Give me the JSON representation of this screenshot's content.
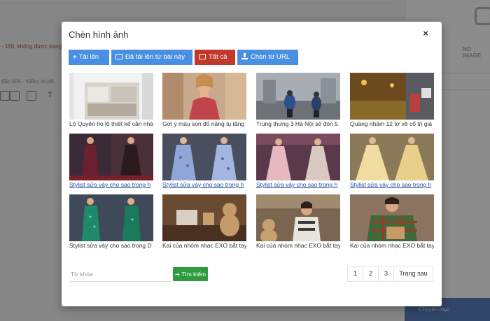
{
  "background": {
    "text1": "- 160, không được trang",
    "text2": "đặc biệt · Kiểm duyệt",
    "noimage": "NO IMAGE",
    "bottom_button": "Chuyên mục"
  },
  "modal": {
    "title": "Chèn hình ảnh",
    "close": "×",
    "tabs": [
      {
        "label": "Tải lên",
        "color": "#4a90e2"
      },
      {
        "label": "Đã tải lên từ bài này",
        "color": "#4a90e2"
      },
      {
        "label": "Tất cả",
        "color": "#c0392b"
      },
      {
        "label": "Chèn từ URL",
        "color": "#4a90e2"
      }
    ],
    "images": [
      {
        "caption": "Lộ Quyên ho lộ thiết kế căn nhà",
        "underline": false,
        "icon": "house-interior-image"
      },
      {
        "caption": "Gợi ý màu son đỏ nâng tụ tăng",
        "underline": false,
        "icon": "model-portrait-image"
      },
      {
        "caption": "Trung thưng 3 Hà Nội sẽ đón 5",
        "underline": false,
        "icon": "street-motorbike-image"
      },
      {
        "caption": "Quảng nhâm 12 tơ vẽ cổ trị giá",
        "underline": false,
        "icon": "night-street-image"
      },
      {
        "caption": "Stylist sửa váy cho sao trong h",
        "underline": true,
        "icon": "red-carpet-dress-image"
      },
      {
        "caption": "Stylist sửa váy cho sao trong h",
        "underline": true,
        "icon": "blue-dress-image"
      },
      {
        "caption": "Stylist sửa váy cho sao trong h",
        "underline": true,
        "icon": "pink-gown-image"
      },
      {
        "caption": "Stylist sửa váy cho sao trong h",
        "underline": true,
        "icon": "yellow-gown-image"
      },
      {
        "caption": "Stylist sửa váy cho sao trong D",
        "underline": false,
        "icon": "green-sequin-dress-image"
      },
      {
        "caption": "Kai của nhóm nhạc EXO bắt tay",
        "underline": false,
        "icon": "teddy-bear-image"
      },
      {
        "caption": "Kai của nhóm nhạc EXO bắt tay",
        "underline": false,
        "icon": "kai-teddy-image"
      },
      {
        "caption": "Kai của nhóm nhạc EXO bắt tay",
        "underline": false,
        "icon": "kai-plaid-shirt-image"
      }
    ],
    "search": {
      "placeholder": "Từ khóa",
      "button_label": "Tìm kiếm"
    },
    "pager": [
      "1",
      "2",
      "3",
      "Trang sau"
    ]
  }
}
